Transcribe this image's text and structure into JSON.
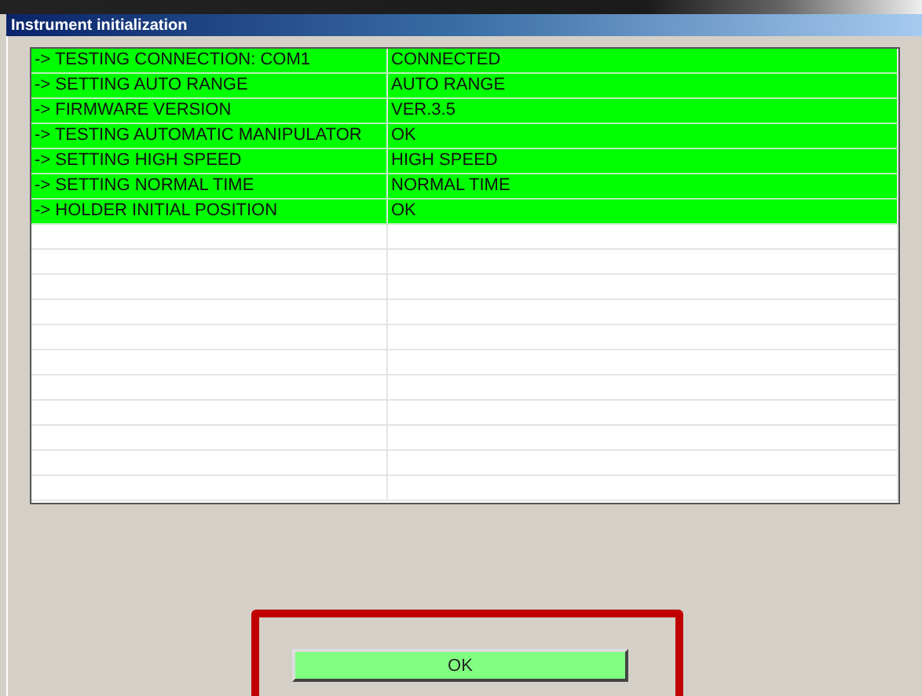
{
  "window": {
    "title": "Instrument initialization"
  },
  "steps": [
    {
      "label": "-> TESTING CONNECTION: COM1",
      "result": "CONNECTED",
      "passed": true
    },
    {
      "label": "-> SETTING AUTO RANGE",
      "result": "AUTO RANGE",
      "passed": true
    },
    {
      "label": "-> FIRMWARE VERSION",
      "result": "VER.3.5",
      "passed": true
    },
    {
      "label": "-> TESTING AUTOMATIC MANIPULATOR",
      "result": "OK",
      "passed": true
    },
    {
      "label": "-> SETTING HIGH SPEED",
      "result": "HIGH SPEED",
      "passed": true
    },
    {
      "label": "-> SETTING NORMAL TIME",
      "result": "NORMAL TIME",
      "passed": true
    },
    {
      "label": "-> HOLDER INITIAL POSITION",
      "result": "OK",
      "passed": true
    }
  ],
  "ok_button": {
    "label": "OK",
    "highlighted": true
  }
}
